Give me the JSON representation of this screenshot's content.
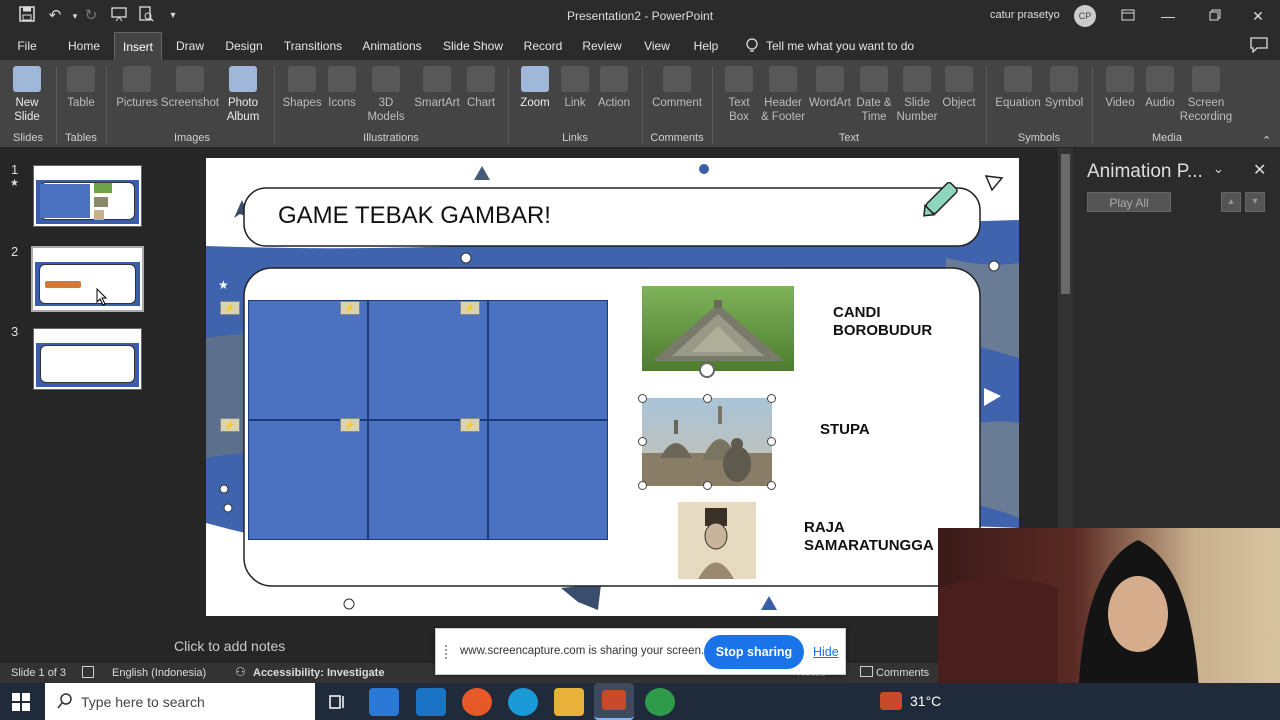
{
  "window": {
    "title": "Presentation2 - PowerPoint",
    "user": "catur prasetyo",
    "initials": "CP"
  },
  "tabs": [
    "File",
    "Home",
    "Insert",
    "Draw",
    "Design",
    "Transitions",
    "Animations",
    "Slide Show",
    "Record",
    "Review",
    "View",
    "Help"
  ],
  "active_tab": "Insert",
  "tell_me": "Tell me what you want to do",
  "ribbon": {
    "buttons": {
      "new_slide": "New Slide",
      "table": "Table",
      "pictures": "Pictures",
      "screenshot": "Screenshot",
      "photo_album": "Photo Album",
      "shapes": "Shapes",
      "icons": "Icons",
      "models3d": "3D Models",
      "smartart": "SmartArt",
      "chart": "Chart",
      "zoom": "Zoom",
      "link": "Link",
      "action": "Action",
      "comment": "Comment",
      "text_box": "Text Box",
      "header_footer": "Header & Footer",
      "wordart": "WordArt",
      "date_time": "Date & Time",
      "slide_number": "Slide Number",
      "object": "Object",
      "equation": "Equation",
      "symbol": "Symbol",
      "video": "Video",
      "audio": "Audio",
      "screen_recording": "Screen Recording"
    },
    "groups": {
      "slides": "Slides",
      "tables": "Tables",
      "images": "Images",
      "illustrations": "Illustrations",
      "links": "Links",
      "comments": "Comments",
      "text": "Text",
      "symbols": "Symbols",
      "media": "Media"
    }
  },
  "slide_numbers": [
    "1",
    "2",
    "3"
  ],
  "slide": {
    "title": "GAME TEBAK GAMBAR!",
    "labels": [
      "CANDI BOROBUDUR",
      "STUPA",
      "RAJA SAMARATUNGGA"
    ]
  },
  "notes_placeholder": "Click to add notes",
  "animation_pane": {
    "title": "Animation P...",
    "play_all": "Play All"
  },
  "status": {
    "slide": "Slide 1 of 3",
    "language": "English (Indonesia)",
    "accessibility": "Accessibility: Investigate",
    "comments": "Comments",
    "notes": "Notes"
  },
  "share_bar": {
    "message": "www.screencapture.com is sharing your screen.",
    "stop": "Stop sharing",
    "hide": "Hide"
  },
  "taskbar": {
    "search_placeholder": "Type here to search",
    "temperature": "31°C"
  }
}
